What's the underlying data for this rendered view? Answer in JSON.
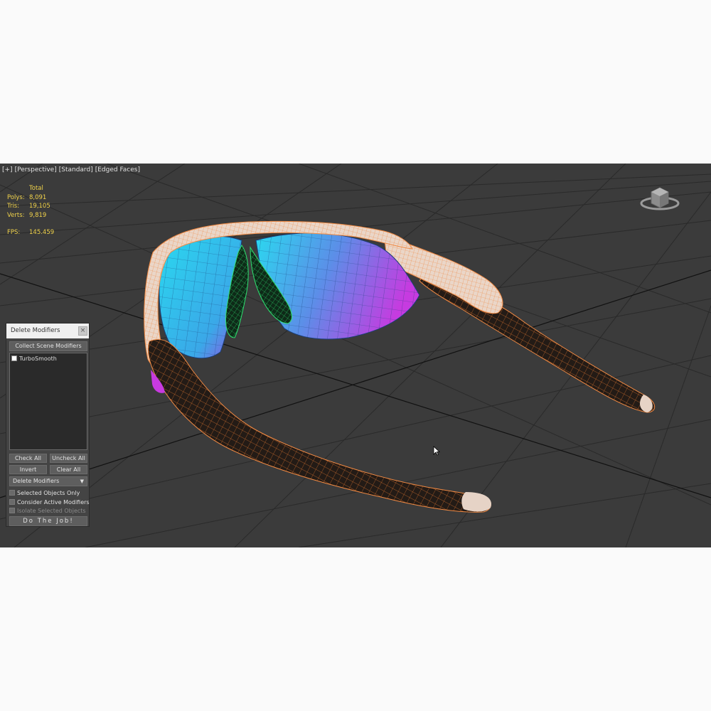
{
  "viewport": {
    "label_parts": [
      "[+]",
      "[Perspective]",
      "[Standard]",
      "[Edged Faces]"
    ],
    "background": "#3b3b3b"
  },
  "stats": {
    "header": "Total",
    "rows": [
      {
        "key": "Polys:",
        "value": "8,091"
      },
      {
        "key": "Tris:",
        "value": "19,105"
      },
      {
        "key": "Verts:",
        "value": "9,819"
      }
    ],
    "fps_key": "FPS:",
    "fps_value": "145.459",
    "color": "#f0d24a"
  },
  "panel": {
    "title": "Delete Modifiers",
    "close_label": "×",
    "collect_button": "Collect Scene Modifiers",
    "list_items": [
      {
        "label": "TurboSmooth",
        "checked": false
      }
    ],
    "check_all": "Check All",
    "uncheck_all": "Uncheck All",
    "invert": "Invert",
    "clear_all": "Clear All",
    "mode_dropdown": "Delete Modifiers",
    "options": [
      {
        "label": "Selected Objects Only",
        "checked": false,
        "enabled": true
      },
      {
        "label": "Consider Active Modifiers",
        "checked": false,
        "enabled": true
      },
      {
        "label": "Isolate Selected Objects",
        "checked": false,
        "enabled": false
      }
    ],
    "do_button": "Do The Job!"
  },
  "icons": {
    "viewcube": "viewcube-icon",
    "cursor": "mouse-pointer-icon",
    "dropdown_arrow": "chevron-down-icon"
  },
  "colors": {
    "wire_orange": "#ff8a3a",
    "lens_cyan": "#29d7ee",
    "lens_magenta": "#c83ae0",
    "nosepad_green": "#1fc25a"
  }
}
